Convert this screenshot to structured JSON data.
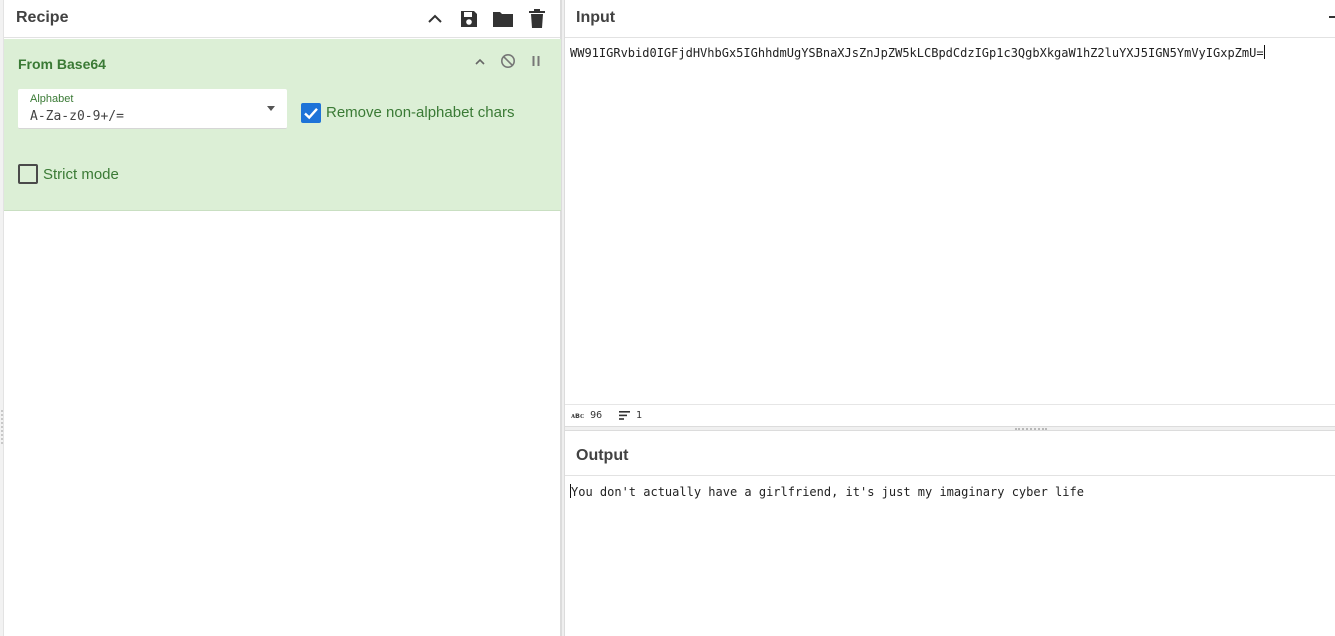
{
  "recipe": {
    "title": "Recipe",
    "icons": [
      "chevron-up-icon",
      "save-icon",
      "folder-icon",
      "trash-icon"
    ],
    "operation": {
      "name": "From Base64",
      "alphabet_label": "Alphabet",
      "alphabet_value": "A-Za-z0-9+/=",
      "remove_non_alphabet_label": "Remove non-alphabet chars",
      "remove_non_alphabet_checked": true,
      "strict_mode_label": "Strict mode",
      "strict_mode_checked": false,
      "bg_color": "#dcefd6",
      "accent_color": "#3a7a35"
    }
  },
  "input": {
    "title": "Input",
    "value": "WW91IGRvbid0IGFjdHVhbGx5IGhhdmUgYSBnaXJsZnJpZW5kLCBpdCdzIGp1c3QgbXkgaW1hZ2luYXJ5IGN5YmVyIGxpZmU=",
    "length_icon": "abc-icon",
    "length": "96",
    "lines": "1"
  },
  "output": {
    "title": "Output",
    "value": "You don't actually have a girlfriend, it's just my imaginary cyber life"
  },
  "colors": {
    "checkbox_checked": "#1e73d8",
    "header_text": "#424242"
  }
}
